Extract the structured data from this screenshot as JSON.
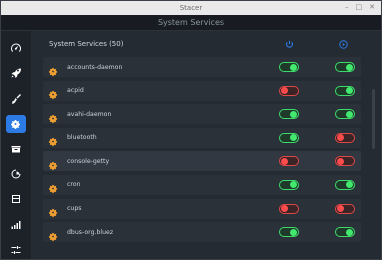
{
  "window": {
    "title": "Stacer"
  },
  "page": {
    "subtitle": "System Services"
  },
  "sidebar": {
    "items": [
      {
        "icon": "dashboard-icon",
        "active": false
      },
      {
        "icon": "rocket-icon",
        "active": false
      },
      {
        "icon": "broom-icon",
        "active": false
      },
      {
        "icon": "gears-icon",
        "active": true
      },
      {
        "icon": "package-icon",
        "active": false
      },
      {
        "icon": "processes-icon",
        "active": false
      },
      {
        "icon": "box-icon",
        "active": false
      },
      {
        "icon": "chart-bars-icon",
        "active": false
      },
      {
        "icon": "sliders-icon",
        "active": false
      }
    ]
  },
  "services": {
    "header": "System Services (50)",
    "columns": [
      {
        "icon": "power-icon"
      },
      {
        "icon": "play-icon"
      }
    ],
    "items": [
      {
        "name": "accounts-daemon",
        "status": true,
        "running": true
      },
      {
        "name": "acpid",
        "status": false,
        "running": true
      },
      {
        "name": "avahi-daemon",
        "status": true,
        "running": true
      },
      {
        "name": "bluetooth",
        "status": true,
        "running": false
      },
      {
        "name": "console-getty",
        "status": false,
        "running": false
      },
      {
        "name": "cron",
        "status": true,
        "running": true
      },
      {
        "name": "cups",
        "status": false,
        "running": false
      },
      {
        "name": "dbus-org.bluez",
        "status": true,
        "running": true
      }
    ]
  },
  "colors": {
    "accent": "#2c7be5",
    "on": "#43e86f",
    "off": "#ff4b4b",
    "gear": "#f0a030"
  }
}
